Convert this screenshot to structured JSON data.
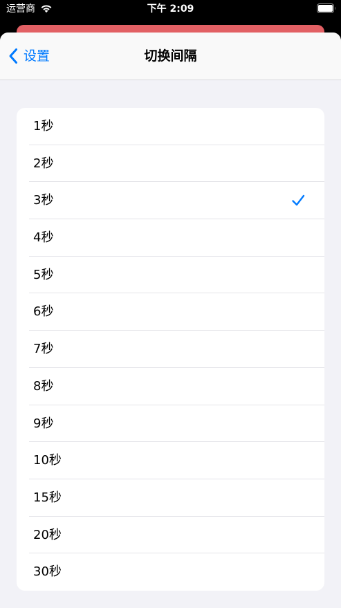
{
  "status_bar": {
    "carrier": "运营商",
    "time": "下午 2:09"
  },
  "nav": {
    "back_label": "设置",
    "title": "切换间隔"
  },
  "colors": {
    "accent": "#007aff",
    "behind_card": "#e26064"
  },
  "options": [
    {
      "label": "1秒",
      "selected": false
    },
    {
      "label": "2秒",
      "selected": false
    },
    {
      "label": "3秒",
      "selected": true
    },
    {
      "label": "4秒",
      "selected": false
    },
    {
      "label": "5秒",
      "selected": false
    },
    {
      "label": "6秒",
      "selected": false
    },
    {
      "label": "7秒",
      "selected": false
    },
    {
      "label": "8秒",
      "selected": false
    },
    {
      "label": "9秒",
      "selected": false
    },
    {
      "label": "10秒",
      "selected": false
    },
    {
      "label": "15秒",
      "selected": false
    },
    {
      "label": "20秒",
      "selected": false
    },
    {
      "label": "30秒",
      "selected": false
    }
  ]
}
